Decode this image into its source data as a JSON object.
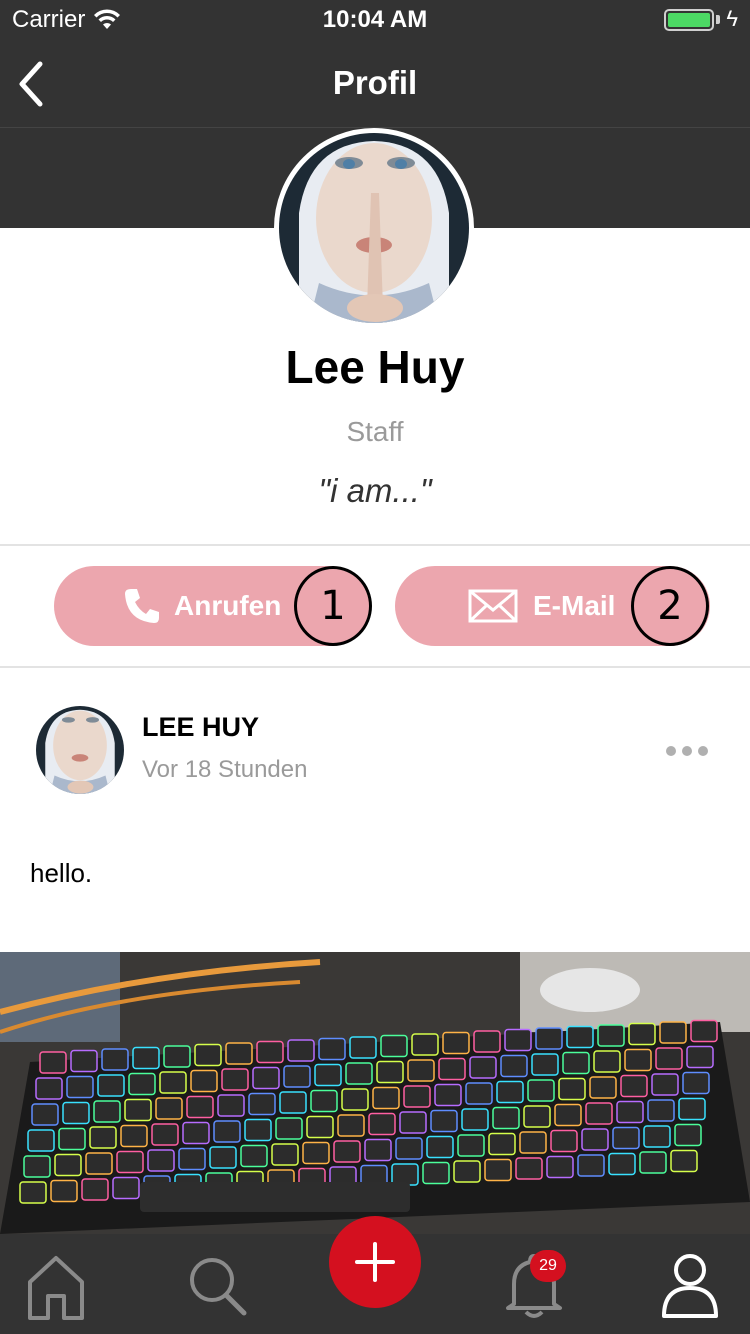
{
  "status_bar": {
    "carrier": "Carrier",
    "time": "10:04 AM",
    "battery_color": "#4cd964"
  },
  "nav": {
    "title": "Profil",
    "back_icon": "chevron-left-icon"
  },
  "profile": {
    "name": "Lee Huy",
    "role": "Staff",
    "quote": "\"i am...\""
  },
  "actions": {
    "call_label": "Anrufen",
    "call_icon": "phone-icon",
    "call_marker": "1",
    "email_label": "E-Mail",
    "email_icon": "envelope-icon",
    "email_marker": "2",
    "pill_color": "#eca6ae"
  },
  "post": {
    "author": "LEE HUY",
    "time": "Vor 18 Stunden",
    "text": "hello.",
    "more_icon": "more-dots-icon"
  },
  "tabbar": {
    "home_icon": "home-icon",
    "search_icon": "search-icon",
    "add_icon": "plus-icon",
    "notifications_icon": "bell-icon",
    "notifications_count": "29",
    "profile_icon": "user-icon",
    "accent_color": "#d4101f"
  }
}
